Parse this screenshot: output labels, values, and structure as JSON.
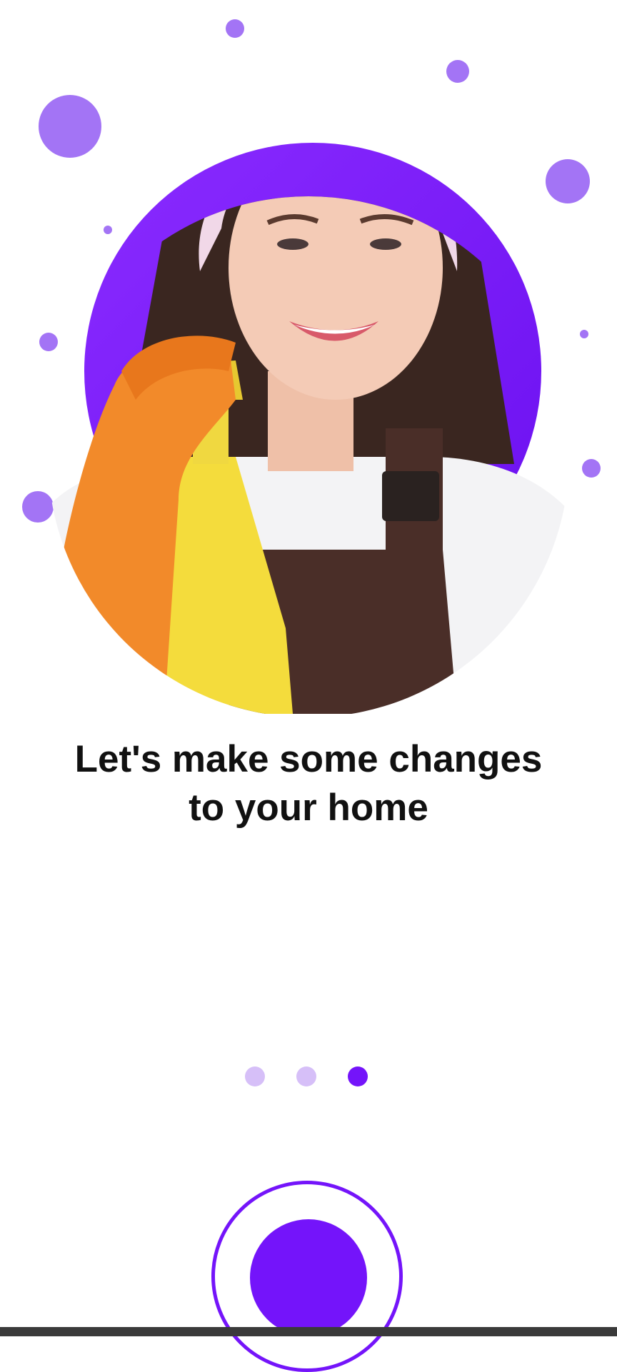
{
  "onboarding": {
    "headline": [
      "Let's make some changes",
      "to your home"
    ],
    "pager": {
      "total": 3,
      "current": 3
    },
    "hero_image": "cleaning-woman-photo"
  },
  "colors": {
    "accent": "#7414fa",
    "bubble": "#a374f5",
    "dot_inactive": "#d6bff8",
    "dot_active": "#7414fa",
    "text": "#111111",
    "background": "#ffffff"
  }
}
